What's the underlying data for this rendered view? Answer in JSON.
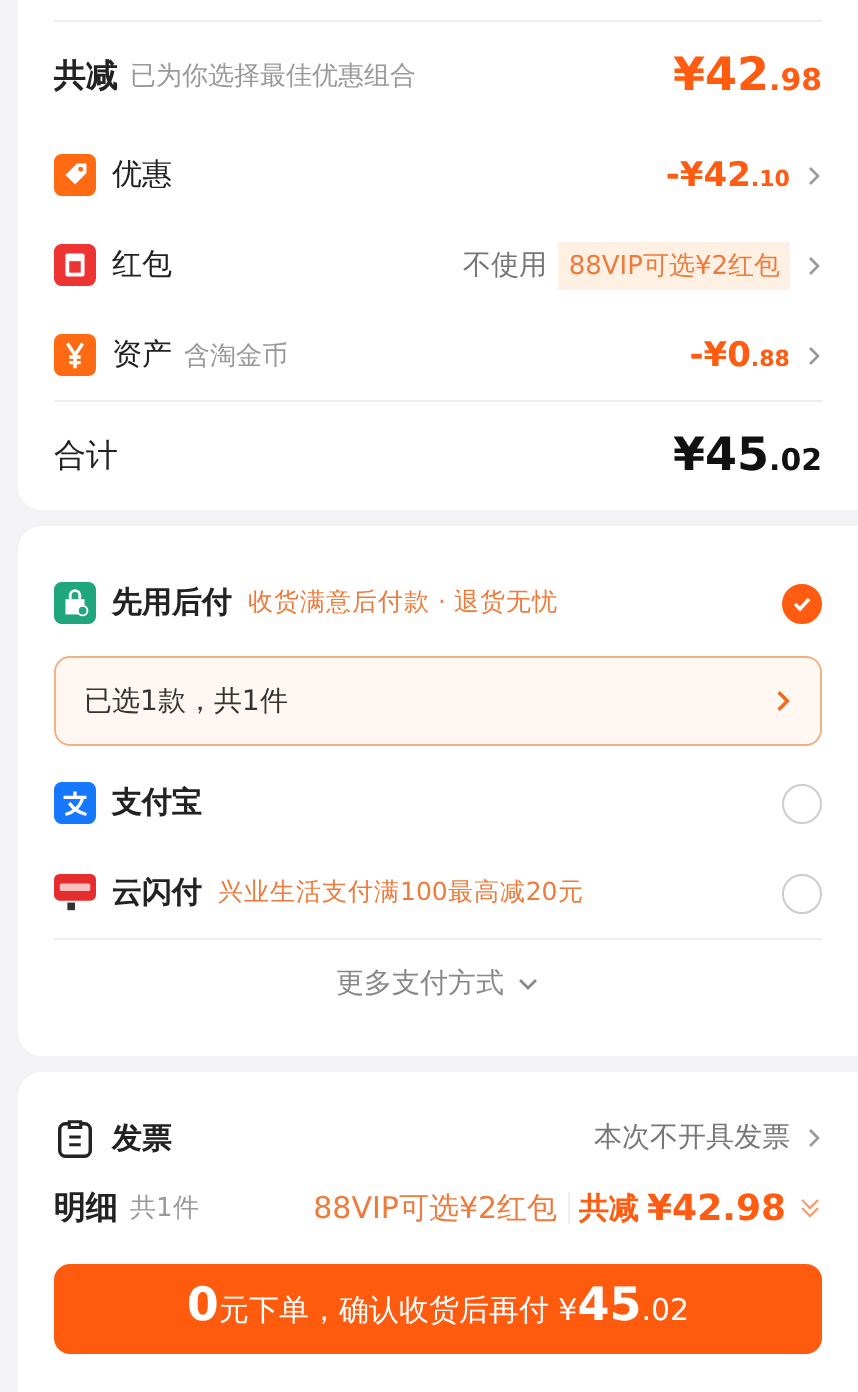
{
  "summary": {
    "label": "共减",
    "hint": "已为你选择最佳优惠组合",
    "amount_main": "¥42",
    "amount_cents": ".98"
  },
  "discounts": [
    {
      "kind": "tag",
      "label": "优惠",
      "amount_main": "-¥42",
      "amount_cents": ".10"
    },
    {
      "kind": "packet",
      "label": "红包",
      "status": "不使用",
      "badge": "88VIP可选¥2红包"
    },
    {
      "kind": "coin",
      "label": "资产",
      "sub": "含淘金币",
      "amount_main": "-¥0",
      "amount_cents": ".88"
    }
  ],
  "total": {
    "label": "合计",
    "amount_main": "¥45",
    "amount_cents": ".02"
  },
  "payments": [
    {
      "kind": "later",
      "name": "先用后付",
      "promo": "收货满意后付款 · 退货无忧",
      "selected": true,
      "detail": "已选1款，共1件"
    },
    {
      "kind": "alipay",
      "name": "支付宝",
      "selected": false
    },
    {
      "kind": "unionpay",
      "name": "云闪付",
      "promo": "兴业生活支付满100最高减20元",
      "selected": false
    }
  ],
  "more_payments": "更多支付方式",
  "invoice": {
    "label": "发票",
    "value": "本次不开具发票"
  },
  "details": {
    "label": "明细",
    "count": "共1件",
    "vip": "88VIP可选¥2红包",
    "saving_label": "共减",
    "saving": "¥42.98"
  },
  "submit": [
    {
      "text": "0",
      "large": true
    },
    {
      "text": "元下单，确认收货后再付 ¥",
      "large": false
    },
    {
      "text": "45",
      "large": true
    },
    {
      "text": ".02",
      "large": false
    }
  ]
}
